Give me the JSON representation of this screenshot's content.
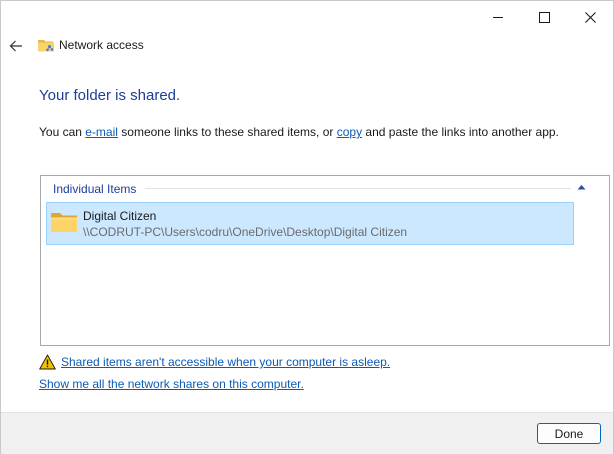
{
  "window": {
    "title": "Network access",
    "controls": {
      "minimize": "minimize-icon",
      "maximize": "maximize-icon",
      "close": "close-icon"
    }
  },
  "icons": {
    "back": "arrow-left-icon",
    "app": "shared-folder-icon",
    "warning": "warning-icon"
  },
  "heading": "Your folder is shared.",
  "description": {
    "prefix": "You can ",
    "email_link": "e-mail",
    "middle": " someone links to these shared items, or ",
    "copy_link": "copy",
    "suffix": " and paste the links into another app."
  },
  "items_panel": {
    "group_label": "Individual Items",
    "items": [
      {
        "name": "Digital Citizen",
        "path": "\\\\CODRUT-PC\\Users\\codru\\OneDrive\\Desktop\\Digital Citizen"
      }
    ]
  },
  "links": {
    "warning": "Shared items aren't accessible when your computer is asleep.",
    "show_shares": "Show me all the network shares on this computer."
  },
  "footer": {
    "done_label": "Done"
  },
  "colors": {
    "accent": "#0067c0",
    "heading": "#1e3d96",
    "link": "#0b5bb5",
    "selection": "#cce8ff",
    "selection_border": "#99d1ff",
    "warning": "#f2c200"
  }
}
